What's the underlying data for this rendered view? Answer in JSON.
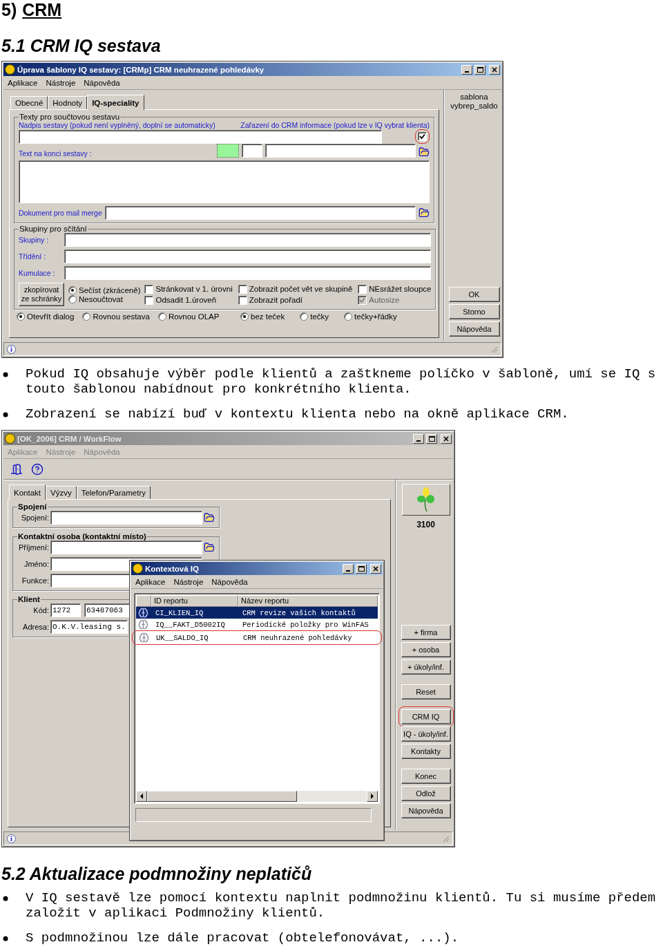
{
  "heading": {
    "number": "5)",
    "title": "CRM"
  },
  "section_1": "5.1 CRM IQ sestava",
  "template_window": {
    "title": "Úprava šablony IQ sestavy: [CRMp] CRM neuhrazené pohledávky",
    "menu": [
      "Aplikace",
      "Nástroje",
      "Nápověda"
    ],
    "tabs": [
      {
        "label": "Obecné",
        "selected": false
      },
      {
        "label": "Hodnoty",
        "selected": false
      },
      {
        "label": "IQ-speciality",
        "selected": true
      }
    ],
    "side_label": [
      "sablona",
      "vybrep_saldo"
    ],
    "texts_group": "Texty pro součtovou sestavu",
    "title_label": "Nadpis sestavy (pokud není vyplněný, doplní se automaticky)",
    "crm_label": "Zařazení do CRM informace (pokud lze v IQ vybrat klienta)",
    "crm_checkbox": {
      "checked": true,
      "highlighted": true
    },
    "end_text_label": "Text na konci sestavy :",
    "mail_merge_label": "Dokument pro mail merge",
    "sum_group": "Skupiny pro sčítání",
    "sum_fields": [
      "Skupiny :",
      "Třídění :",
      "Kumulace :"
    ],
    "copy_button": "zkopírovat ze schránky",
    "sum_radios": [
      {
        "label": "Sečíst (zkráceně)",
        "selected": true
      },
      {
        "label": "Nesoučtovat",
        "selected": false
      }
    ],
    "checks": [
      {
        "label": "Stránkovat v 1. úrovni",
        "checked": false,
        "disabled": false
      },
      {
        "label": "Odsadit 1.úroveň",
        "checked": false,
        "disabled": false
      },
      {
        "label": "Zobrazit počet vět ve skupině",
        "checked": false,
        "disabled": false
      },
      {
        "label": "Zobrazit pořadí",
        "checked": false,
        "disabled": false
      },
      {
        "label": "NEsrážet sloupce",
        "checked": false,
        "disabled": false
      },
      {
        "label": "Autosize",
        "checked": true,
        "disabled": true
      }
    ],
    "output_radios": [
      {
        "label": "Otevřít dialog",
        "selected": true
      },
      {
        "label": "Rovnou sestava",
        "selected": false
      },
      {
        "label": "Rovnou OLAP",
        "selected": false
      }
    ],
    "dot_radios": [
      {
        "label": "bez teček",
        "selected": true
      },
      {
        "label": "tečky",
        "selected": false
      },
      {
        "label": "tečky+řádky",
        "selected": false
      }
    ],
    "buttons": [
      "OK",
      "Storno",
      "Nápověda"
    ]
  },
  "bullets_1": [
    {
      "lines": [
        "Pokud IQ obsahuje výběr podle klientů a zaštkneme políčko v šabloně, umí se IQ s",
        "touto šablonou nabídnout pro konkrétního klienta."
      ]
    },
    {
      "lines": [
        "Zobrazení se nabízí buď v kontextu klienta nebo na okně aplikace CRM."
      ]
    }
  ],
  "crm_window": {
    "title": "[OK_2006] CRM / WorkFlow",
    "active": false,
    "menu": [
      {
        "label": "Aplikace",
        "disabled": true
      },
      {
        "label": "Nástroje",
        "disabled": true
      },
      {
        "label": "Nápověda",
        "disabled": true
      }
    ],
    "tabs": [
      {
        "label": "Kontakt",
        "selected": true
      },
      {
        "label": "Výzvy",
        "selected": false
      },
      {
        "label": "Telefon/Parametry",
        "selected": false
      }
    ],
    "groups": [
      {
        "title": "Spojení",
        "fields": [
          {
            "label": "Spojení:",
            "folder": true
          }
        ]
      },
      {
        "title": "Kontaktní osoba (kontaktní místo)",
        "fields": [
          {
            "label": "Příjmení:",
            "folder": true
          },
          {
            "label": "Jméno:",
            "folder": false
          },
          {
            "label": "Funkce:",
            "folder": false
          }
        ]
      },
      {
        "title": "Klient",
        "fields": [
          {
            "label": "Kód:",
            "values": [
              "1272",
              "63487063"
            ]
          },
          {
            "label": "Adresa:",
            "values": [
              "O.K.V.leasing s."
            ]
          }
        ]
      }
    ],
    "badge": "3100",
    "button_groups": [
      [
        {
          "label": "+ firma",
          "highlighted": false
        },
        {
          "label": "+ osoba",
          "highlighted": false
        },
        {
          "label": "+ úkoly/inf.",
          "highlighted": false
        }
      ],
      [
        {
          "label": "Reset",
          "highlighted": false
        }
      ],
      [
        {
          "label": "CRM IQ",
          "highlighted": true
        },
        {
          "label": "IQ - úkoly/inf.",
          "highlighted": false
        },
        {
          "label": "Kontakty",
          "highlighted": false
        }
      ],
      [
        {
          "label": "Konec",
          "highlighted": false
        },
        {
          "label": "Odlož",
          "highlighted": false
        },
        {
          "label": "Nápověda",
          "highlighted": false
        }
      ]
    ],
    "popup": {
      "title": "Kontextová IQ",
      "active": true,
      "menu": [
        "Aplikace",
        "Nástroje",
        "Nápověda"
      ],
      "columns": [
        "ID reportu",
        "Název reportu"
      ],
      "rows": [
        {
          "id": "CI_KLIEN_IQ",
          "name": "CRM revize vašich kontaktů",
          "selected": true,
          "highlighted": false
        },
        {
          "id": "IQ__FAKT_D5002IQ",
          "name": "Periodické položky pro WinFAS",
          "selected": false,
          "highlighted": false
        },
        {
          "id": "UK__SALDO_IQ",
          "name": "CRM neuhrazené pohledávky",
          "selected": false,
          "highlighted": true
        }
      ]
    }
  },
  "section_2": "5.2 Aktualizace podmnožiny neplatičů",
  "bullets_2": [
    {
      "lines": [
        "V IQ sestavě lze pomocí kontextu naplnit podmnožinu klientů. Tu si musíme předem",
        "založit v aplikaci Podmnožiny klientů."
      ]
    },
    {
      "lines": [
        "S podmnožinou lze dále pracovat (obtelefonovávat, ...)."
      ]
    }
  ]
}
